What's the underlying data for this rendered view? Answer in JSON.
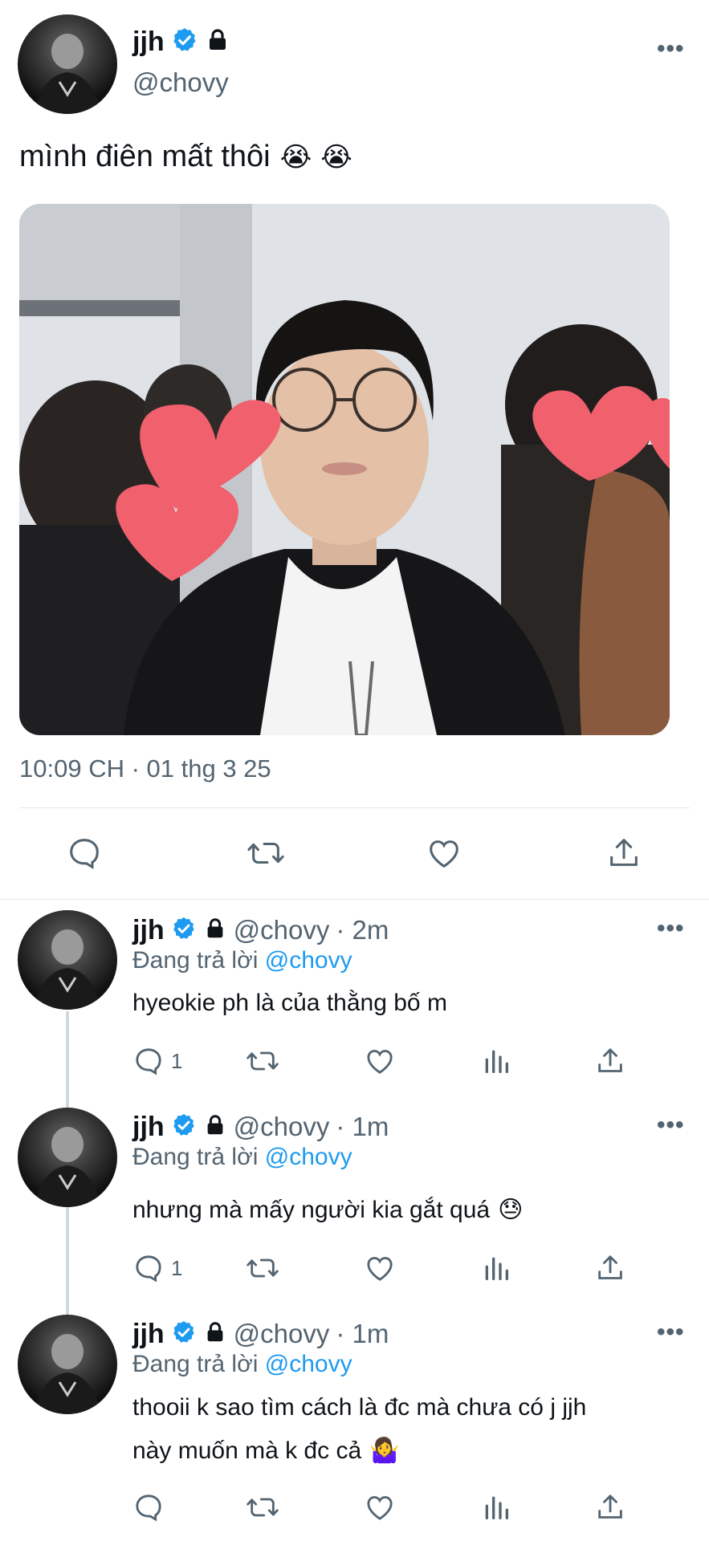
{
  "main_tweet": {
    "name": "jjh",
    "handle": "@chovy",
    "text": "mình điên mất thôi",
    "emoji": "😭 😭",
    "timestamp": "10:09 CH · 01 thg 3 25"
  },
  "replies": [
    {
      "name": "jjh",
      "handle": "@chovy",
      "time": "· 2m",
      "replying_prefix": "Đang trả lời",
      "replying_to": "@chovy",
      "text": "hyeokie ph là của thằng bố m",
      "reply_count": "1"
    },
    {
      "name": "jjh",
      "handle": "@chovy",
      "time": "· 1m",
      "replying_prefix": "Đang trả lời",
      "replying_to": "@chovy",
      "text": "nhưng mà mấy người kia gắt quá",
      "emoji": "😓",
      "reply_count": "1"
    },
    {
      "name": "jjh",
      "handle": "@chovy",
      "time": "· 1m",
      "replying_prefix": "Đang trả lời",
      "replying_to": "@chovy",
      "text_line1": "thooii k sao tìm cách là đc mà chưa có j jjh",
      "text_line2": "này muốn mà k đc cả",
      "emoji": "🤷‍♀️",
      "reply_count": ""
    }
  ],
  "more_label": "•••",
  "colors": {
    "accent": "#1d9bf0",
    "text": "#0f1419",
    "secondary": "#536471",
    "heart_sticker": "#f0606d"
  },
  "icons": [
    "verified-badge-icon",
    "lock-icon",
    "reply-icon",
    "retweet-icon",
    "like-icon",
    "share-icon",
    "views-icon",
    "more-icon"
  ]
}
